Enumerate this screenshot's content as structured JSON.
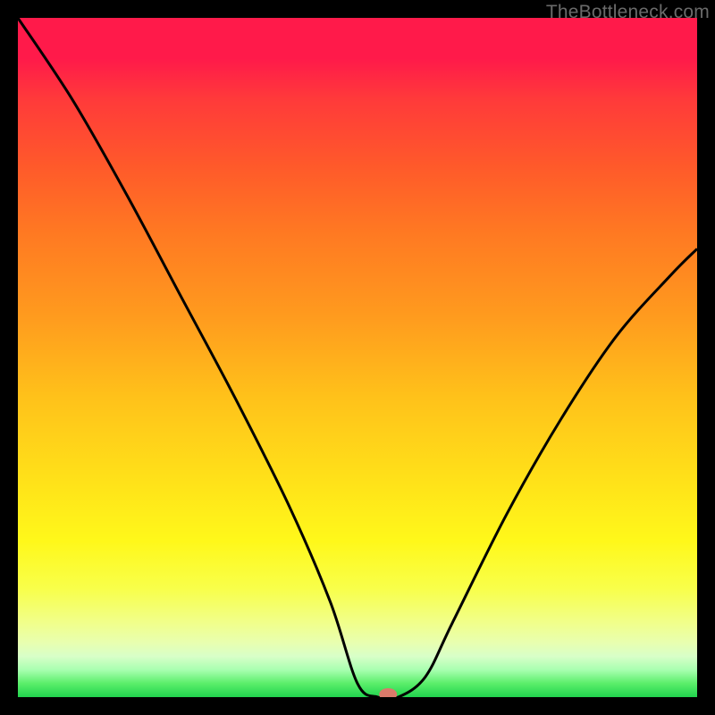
{
  "watermark": "TheBottleneck.com",
  "chart_data": {
    "type": "line",
    "title": "",
    "xlabel": "",
    "ylabel": "",
    "xlim": [
      0,
      100
    ],
    "ylim": [
      0,
      100
    ],
    "legend": false,
    "grid": false,
    "background": "rainbow-vertical-gradient",
    "series": [
      {
        "name": "bottleneck-curve",
        "x": [
          0,
          8,
          16,
          24,
          32,
          40,
          46,
          50,
          53,
          56,
          60,
          64,
          72,
          80,
          88,
          96,
          100
        ],
        "values": [
          100,
          88,
          74,
          59,
          44,
          28,
          14,
          2,
          0,
          0,
          3,
          11,
          27,
          41,
          53,
          62,
          66
        ]
      }
    ],
    "marker": {
      "x": 54.5,
      "y": 0.4,
      "color": "#d97a6a"
    },
    "colors": {
      "curve": "#000000",
      "frame": "#000000",
      "gradient_top": "#ff1a4a",
      "gradient_bottom": "#21d34e"
    }
  }
}
